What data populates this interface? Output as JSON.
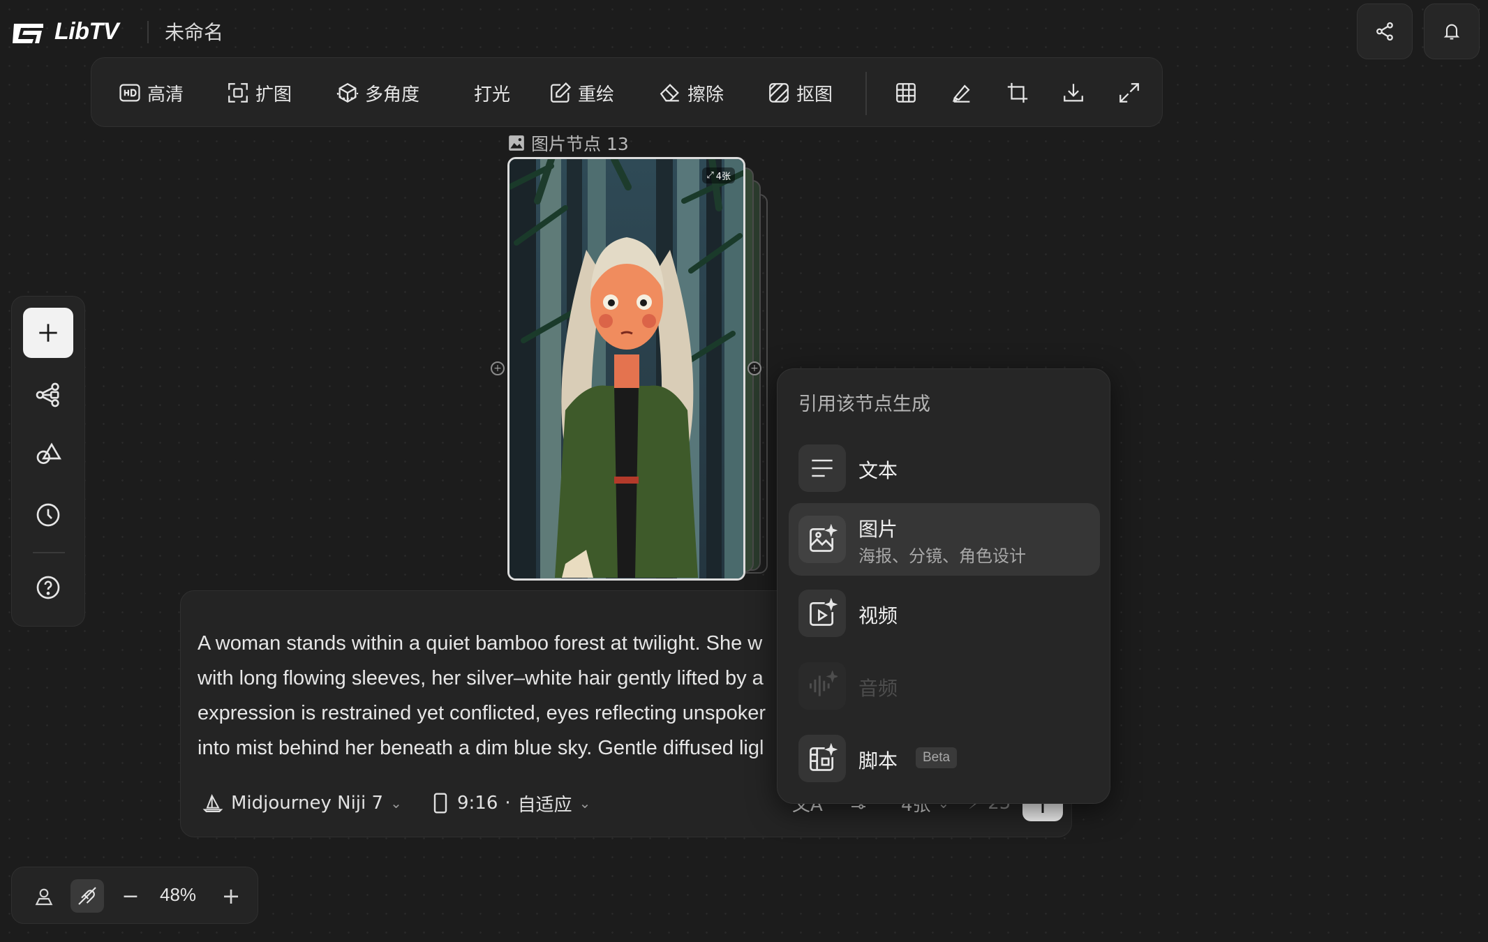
{
  "app": {
    "name": "LibTV",
    "doc_title": "未命名"
  },
  "toolbar": {
    "tools": [
      {
        "label": "高清",
        "icon": "hd-icon"
      },
      {
        "label": "扩图",
        "icon": "expand-image-icon"
      },
      {
        "label": "多角度",
        "icon": "multi-angle-icon"
      },
      {
        "label": "打光",
        "icon": "lighting-icon"
      },
      {
        "label": "重绘",
        "icon": "redraw-icon"
      },
      {
        "label": "擦除",
        "icon": "eraser-icon"
      },
      {
        "label": "抠图",
        "icon": "cutout-icon"
      }
    ],
    "icon_tools": [
      "grid-icon",
      "brush-icon",
      "crop-icon",
      "download-icon",
      "fullscreen-icon"
    ]
  },
  "node": {
    "label": "图片节点 13",
    "count": "4张"
  },
  "rail": {
    "items": [
      "add-icon",
      "workflow-icon",
      "shapes-icon",
      "history-icon",
      "help-icon"
    ]
  },
  "prompt": {
    "lines": [
      "A woman stands within a quiet bamboo forest at twilight. She w",
      "with long flowing sleeves, her silver–white hair gently lifted by a",
      "expression is restrained yet conflicted, eyes reflecting unspoker",
      "into mist behind her beneath a dim blue sky. Gentle diffused ligl"
    ],
    "model": "Midjourney Niji 7",
    "ratio": "9:16",
    "ratio_sep": "·",
    "ratio_mode": "自适应",
    "count": "4张",
    "credits": "25"
  },
  "menu": {
    "title": "引用该节点生成",
    "items": [
      {
        "label": "文本",
        "sub": "",
        "icon": "text-icon",
        "selected": false,
        "disabled": false,
        "badge": ""
      },
      {
        "label": "图片",
        "sub": "海报、分镜、角色设计",
        "icon": "image-ai-icon",
        "selected": true,
        "disabled": false,
        "badge": ""
      },
      {
        "label": "视频",
        "sub": "",
        "icon": "video-ai-icon",
        "selected": false,
        "disabled": false,
        "badge": ""
      },
      {
        "label": "音频",
        "sub": "",
        "icon": "audio-icon",
        "selected": false,
        "disabled": true,
        "badge": ""
      },
      {
        "label": "脚本",
        "sub": "",
        "icon": "script-icon",
        "selected": false,
        "disabled": false,
        "badge": "Beta"
      }
    ]
  },
  "zoom": {
    "value": "48%",
    "minus": "−",
    "plus": "+"
  }
}
